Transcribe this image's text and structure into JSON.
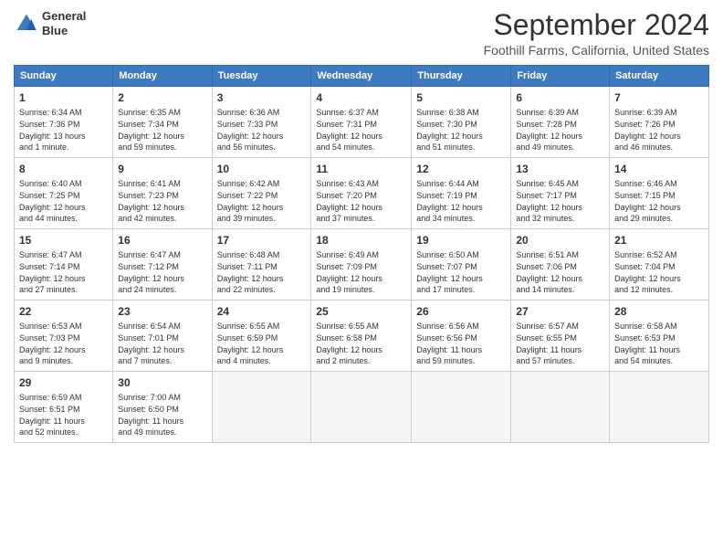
{
  "logo": {
    "line1": "General",
    "line2": "Blue"
  },
  "title": "September 2024",
  "location": "Foothill Farms, California, United States",
  "days_of_week": [
    "Sunday",
    "Monday",
    "Tuesday",
    "Wednesday",
    "Thursday",
    "Friday",
    "Saturday"
  ],
  "weeks": [
    [
      {
        "day": 1,
        "sunrise": "6:34 AM",
        "sunset": "7:36 PM",
        "daylight": "13 hours and 1 minute."
      },
      {
        "day": 2,
        "sunrise": "6:35 AM",
        "sunset": "7:34 PM",
        "daylight": "12 hours and 59 minutes."
      },
      {
        "day": 3,
        "sunrise": "6:36 AM",
        "sunset": "7:33 PM",
        "daylight": "12 hours and 56 minutes."
      },
      {
        "day": 4,
        "sunrise": "6:37 AM",
        "sunset": "7:31 PM",
        "daylight": "12 hours and 54 minutes."
      },
      {
        "day": 5,
        "sunrise": "6:38 AM",
        "sunset": "7:30 PM",
        "daylight": "12 hours and 51 minutes."
      },
      {
        "day": 6,
        "sunrise": "6:39 AM",
        "sunset": "7:28 PM",
        "daylight": "12 hours and 49 minutes."
      },
      {
        "day": 7,
        "sunrise": "6:39 AM",
        "sunset": "7:26 PM",
        "daylight": "12 hours and 46 minutes."
      }
    ],
    [
      {
        "day": 8,
        "sunrise": "6:40 AM",
        "sunset": "7:25 PM",
        "daylight": "12 hours and 44 minutes."
      },
      {
        "day": 9,
        "sunrise": "6:41 AM",
        "sunset": "7:23 PM",
        "daylight": "12 hours and 42 minutes."
      },
      {
        "day": 10,
        "sunrise": "6:42 AM",
        "sunset": "7:22 PM",
        "daylight": "12 hours and 39 minutes."
      },
      {
        "day": 11,
        "sunrise": "6:43 AM",
        "sunset": "7:20 PM",
        "daylight": "12 hours and 37 minutes."
      },
      {
        "day": 12,
        "sunrise": "6:44 AM",
        "sunset": "7:19 PM",
        "daylight": "12 hours and 34 minutes."
      },
      {
        "day": 13,
        "sunrise": "6:45 AM",
        "sunset": "7:17 PM",
        "daylight": "12 hours and 32 minutes."
      },
      {
        "day": 14,
        "sunrise": "6:46 AM",
        "sunset": "7:15 PM",
        "daylight": "12 hours and 29 minutes."
      }
    ],
    [
      {
        "day": 15,
        "sunrise": "6:47 AM",
        "sunset": "7:14 PM",
        "daylight": "12 hours and 27 minutes."
      },
      {
        "day": 16,
        "sunrise": "6:47 AM",
        "sunset": "7:12 PM",
        "daylight": "12 hours and 24 minutes."
      },
      {
        "day": 17,
        "sunrise": "6:48 AM",
        "sunset": "7:11 PM",
        "daylight": "12 hours and 22 minutes."
      },
      {
        "day": 18,
        "sunrise": "6:49 AM",
        "sunset": "7:09 PM",
        "daylight": "12 hours and 19 minutes."
      },
      {
        "day": 19,
        "sunrise": "6:50 AM",
        "sunset": "7:07 PM",
        "daylight": "12 hours and 17 minutes."
      },
      {
        "day": 20,
        "sunrise": "6:51 AM",
        "sunset": "7:06 PM",
        "daylight": "12 hours and 14 minutes."
      },
      {
        "day": 21,
        "sunrise": "6:52 AM",
        "sunset": "7:04 PM",
        "daylight": "12 hours and 12 minutes."
      }
    ],
    [
      {
        "day": 22,
        "sunrise": "6:53 AM",
        "sunset": "7:03 PM",
        "daylight": "12 hours and 9 minutes."
      },
      {
        "day": 23,
        "sunrise": "6:54 AM",
        "sunset": "7:01 PM",
        "daylight": "12 hours and 7 minutes."
      },
      {
        "day": 24,
        "sunrise": "6:55 AM",
        "sunset": "6:59 PM",
        "daylight": "12 hours and 4 minutes."
      },
      {
        "day": 25,
        "sunrise": "6:55 AM",
        "sunset": "6:58 PM",
        "daylight": "12 hours and 2 minutes."
      },
      {
        "day": 26,
        "sunrise": "6:56 AM",
        "sunset": "6:56 PM",
        "daylight": "11 hours and 59 minutes."
      },
      {
        "day": 27,
        "sunrise": "6:57 AM",
        "sunset": "6:55 PM",
        "daylight": "11 hours and 57 minutes."
      },
      {
        "day": 28,
        "sunrise": "6:58 AM",
        "sunset": "6:53 PM",
        "daylight": "11 hours and 54 minutes."
      }
    ],
    [
      {
        "day": 29,
        "sunrise": "6:59 AM",
        "sunset": "6:51 PM",
        "daylight": "11 hours and 52 minutes."
      },
      {
        "day": 30,
        "sunrise": "7:00 AM",
        "sunset": "6:50 PM",
        "daylight": "11 hours and 49 minutes."
      },
      null,
      null,
      null,
      null,
      null
    ]
  ]
}
